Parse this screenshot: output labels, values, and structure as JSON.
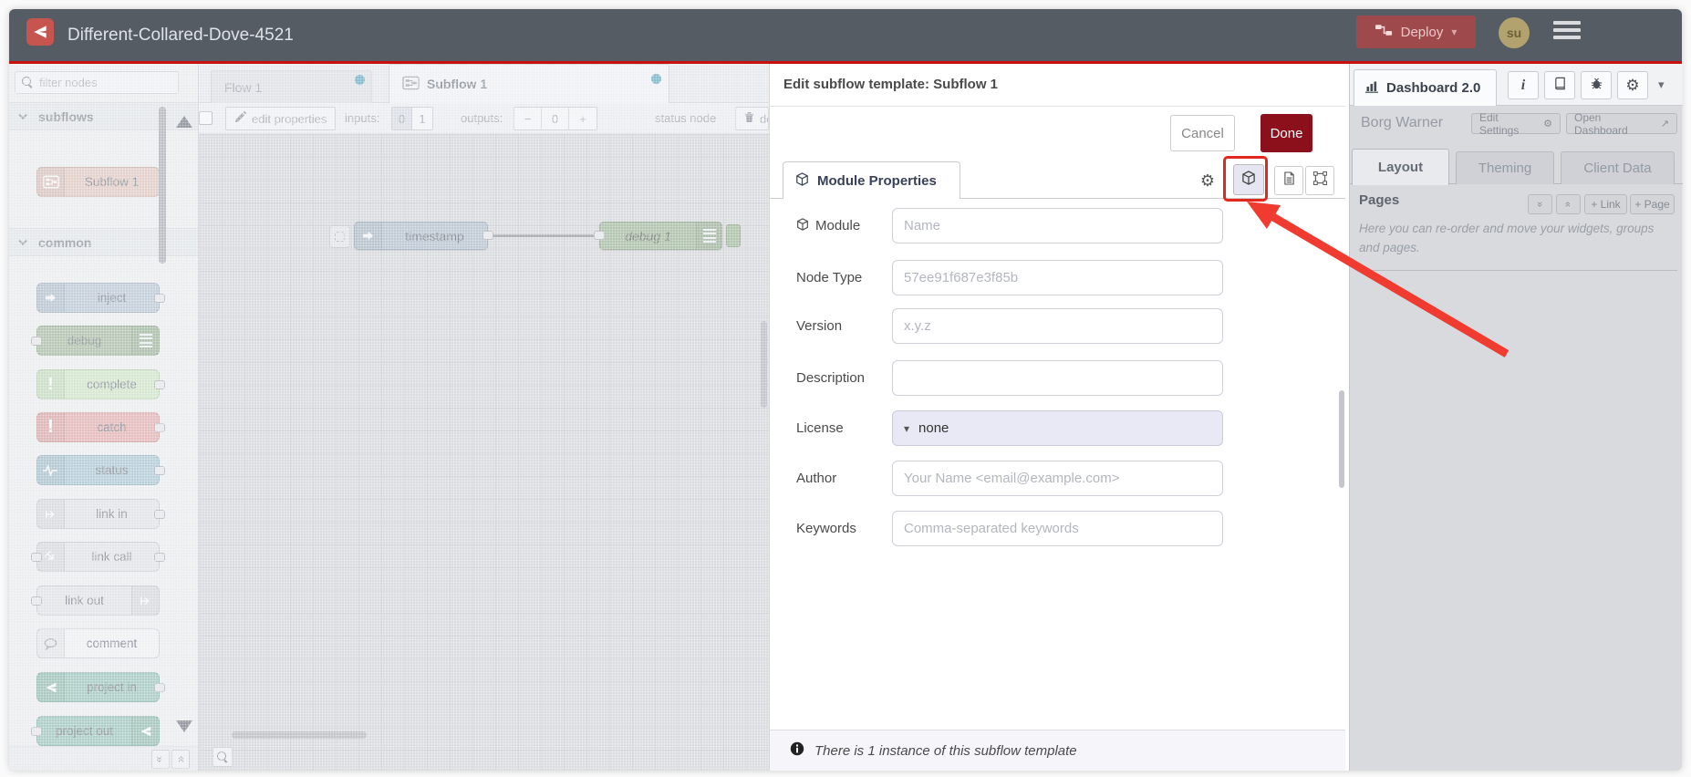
{
  "colors": {
    "header_bg": "#565c64",
    "header_red_line": "#c9100f",
    "logo_red": "#c65550",
    "deploy_bg": "#9e4a4d",
    "avatar_bg": "#b2a26d",
    "tab_dot_blue": "#5ba7c2",
    "done_button_red": "#8c101c",
    "annotation_red": "#e2271e",
    "selected_icon_button_bg": "#e6e6f2"
  },
  "header": {
    "title": "Different-Collared-Dove-4521",
    "deploy_label": "Deploy",
    "avatar_initials": "su"
  },
  "palette": {
    "filter_placeholder": "filter nodes",
    "categories": [
      {
        "label": "subflows",
        "nodes": [
          {
            "label": "Subflow 1",
            "color": "#e2c6bd",
            "border": "#c3a79e",
            "icon": "subflow-icon"
          }
        ]
      },
      {
        "label": "common",
        "nodes": [
          {
            "label": "inject",
            "color": "#b6c4d3",
            "border": "#98a7b6",
            "icon": "inject-arrow-icon"
          },
          {
            "label": "debug",
            "color": "#a2b89c",
            "border": "#879d81",
            "icon": "debug-list-icon"
          },
          {
            "label": "complete",
            "color": "#cde4c3",
            "border": "#aec9a3",
            "icon": "exclamation-icon"
          },
          {
            "label": "catch",
            "color": "#e5a9a9",
            "border": "#c98e8e",
            "icon": "exclamation-icon"
          },
          {
            "label": "status",
            "color": "#a7c4d3",
            "border": "#8aa9ba",
            "icon": "status-wave-icon"
          },
          {
            "label": "link in",
            "color": "#e2e3e6",
            "border": "#c2c4c9",
            "icon": "link-icon"
          },
          {
            "label": "link call",
            "color": "#e2e3e6",
            "border": "#c2c4c9",
            "icon": "link-icon"
          },
          {
            "label": "link out",
            "color": "#e2e3e6",
            "border": "#c2c4c9",
            "icon": "link-icon"
          },
          {
            "label": "comment",
            "color": "#f2f3f5",
            "border": "#c9cbd0",
            "icon": "comment-bubble-icon"
          },
          {
            "label": "project in",
            "color": "#96c3b6",
            "border": "#76a99b",
            "icon": "node-red-icon"
          },
          {
            "label": "project out",
            "color": "#96c3b6",
            "border": "#76a99b",
            "icon": "node-red-icon"
          }
        ]
      }
    ]
  },
  "workspace": {
    "tabs": [
      {
        "label": "Flow 1"
      },
      {
        "label": "Subflow 1"
      }
    ],
    "toolbar": {
      "edit_properties": "edit properties",
      "inputs_label": "inputs:",
      "input_options": [
        "0",
        "1"
      ],
      "outputs_label": "outputs:",
      "output_buttons": [
        "−",
        "0",
        "+"
      ],
      "status_node_label": "status node",
      "delete_label": "delete subflow"
    },
    "canvas": {
      "nodes": [
        {
          "label": "timestamp",
          "color": "#aebccb",
          "border": "#8d9baa"
        },
        {
          "label": "debug 1",
          "color": "#9cb295",
          "border": "#81977a"
        }
      ]
    }
  },
  "dialog": {
    "title": "Edit subflow template: Subflow 1",
    "cancel_label": "Cancel",
    "done_label": "Done",
    "tab_label": "Module Properties",
    "fields": [
      {
        "label": "Module",
        "placeholder": "Name"
      },
      {
        "label": "Node Type",
        "placeholder": "57ee91f687e3f85b"
      },
      {
        "label": "Version",
        "placeholder": "x.y.z"
      },
      {
        "label": "Description",
        "placeholder": ""
      },
      {
        "label": "License",
        "value": "none"
      },
      {
        "label": "Author",
        "placeholder": "Your Name <email@example.com>"
      },
      {
        "label": "Keywords",
        "placeholder": "Comma-separated keywords"
      }
    ],
    "footer_note": "There is 1 instance of this subflow template"
  },
  "sidebar": {
    "tab_label": "Dashboard 2.0",
    "project_name": "Borg Warner",
    "edit_settings_label": "Edit Settings",
    "open_dashboard_label": "Open Dashboard",
    "tabs": [
      "Layout",
      "Theming",
      "Client Data"
    ],
    "pages_label": "Pages",
    "link_button": "+ Link",
    "page_button": "+ Page",
    "help_text": "Here you can re-order and move your widgets, groups and pages."
  },
  "icons": {
    "gear": "⚙",
    "caret_down": "▾",
    "external_link": "↗",
    "exclamation": "!",
    "double_chevron": "»"
  }
}
